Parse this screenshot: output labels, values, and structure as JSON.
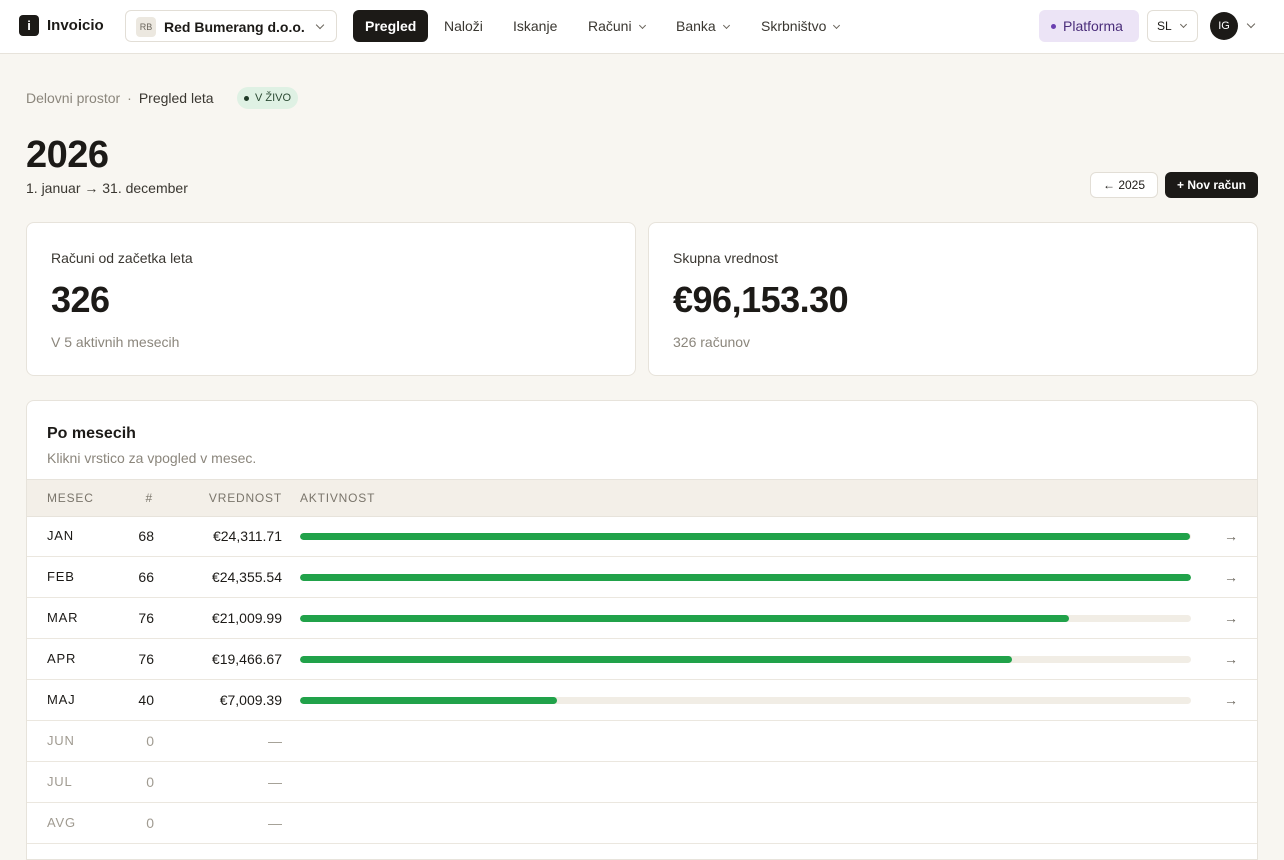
{
  "app": {
    "name": "Invoicio",
    "logo_glyph": "i"
  },
  "org": {
    "initials": "RB",
    "name": "Red Bumerang d.o.o."
  },
  "nav": {
    "items": [
      {
        "label": "Pregled",
        "active": true,
        "dropdown": false
      },
      {
        "label": "Naloži",
        "active": false,
        "dropdown": false
      },
      {
        "label": "Iskanje",
        "active": false,
        "dropdown": false
      },
      {
        "label": "Računi",
        "active": false,
        "dropdown": true
      },
      {
        "label": "Banka",
        "active": false,
        "dropdown": true
      },
      {
        "label": "Skrbništvo",
        "active": false,
        "dropdown": true
      }
    ]
  },
  "topbar": {
    "platform_label": "Platforma",
    "language": "SL",
    "user_initials": "IG"
  },
  "breadcrumb": {
    "root": "Delovni prostor",
    "separator": "·",
    "current": "Pregled leta",
    "live_badge": "V ŽIVO"
  },
  "header": {
    "year": "2026",
    "range": "1. januar → 31. december",
    "prev_label": "← 2025",
    "new_label": "+ Nov račun"
  },
  "stats": [
    {
      "label": "Računi od začetka leta",
      "value": "326",
      "sub": "V 5 aktivnih mesecih"
    },
    {
      "label": "Skupna vrednost",
      "value": "€96,153.30",
      "sub": "326 računov"
    }
  ],
  "monthly": {
    "title": "Po mesecih",
    "subtitle": "Klikni vrstico za vpogled v mesec.",
    "columns": {
      "month": "MESEC",
      "count": "#",
      "value": "VREDNOST",
      "activity": "AKTIVNOST"
    },
    "rows": [
      {
        "month": "JAN",
        "count": "68",
        "value": "€24,311.71",
        "activity": 0.999,
        "active": true
      },
      {
        "month": "FEB",
        "count": "66",
        "value": "€24,355.54",
        "activity": 1.0,
        "active": true
      },
      {
        "month": "MAR",
        "count": "76",
        "value": "€21,009.99",
        "activity": 0.863,
        "active": true
      },
      {
        "month": "APR",
        "count": "76",
        "value": "€19,466.67",
        "activity": 0.799,
        "active": true
      },
      {
        "month": "MAJ",
        "count": "40",
        "value": "€7,009.39",
        "activity": 0.288,
        "active": true
      },
      {
        "month": "JUN",
        "count": "0",
        "value": "—",
        "activity": 0,
        "active": false
      },
      {
        "month": "JUL",
        "count": "0",
        "value": "—",
        "activity": 0,
        "active": false
      },
      {
        "month": "AVG",
        "count": "0",
        "value": "—",
        "activity": 0,
        "active": false
      }
    ],
    "bar_color": "#21a24a",
    "row_arrow": "→"
  }
}
